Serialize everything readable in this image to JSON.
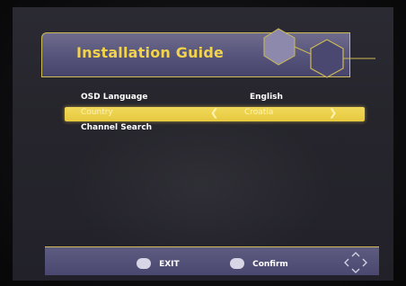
{
  "header": {
    "title": "Installation Guide"
  },
  "menu": {
    "items": [
      {
        "label": "OSD Language",
        "value": "English",
        "selected": false
      },
      {
        "label": "Country",
        "value": "Croatia",
        "selected": true
      },
      {
        "label": "Channel Search",
        "value": "",
        "selected": false
      }
    ],
    "arrow_left": "❮",
    "arrow_right": "❯"
  },
  "footer": {
    "exit_label": "EXIT",
    "confirm_label": "Confirm",
    "nav_icon": "dpad-arrows-icon"
  },
  "colors": {
    "accent": "#e7c93f",
    "header_bg": "#55537a",
    "title": "#f2d34a"
  }
}
